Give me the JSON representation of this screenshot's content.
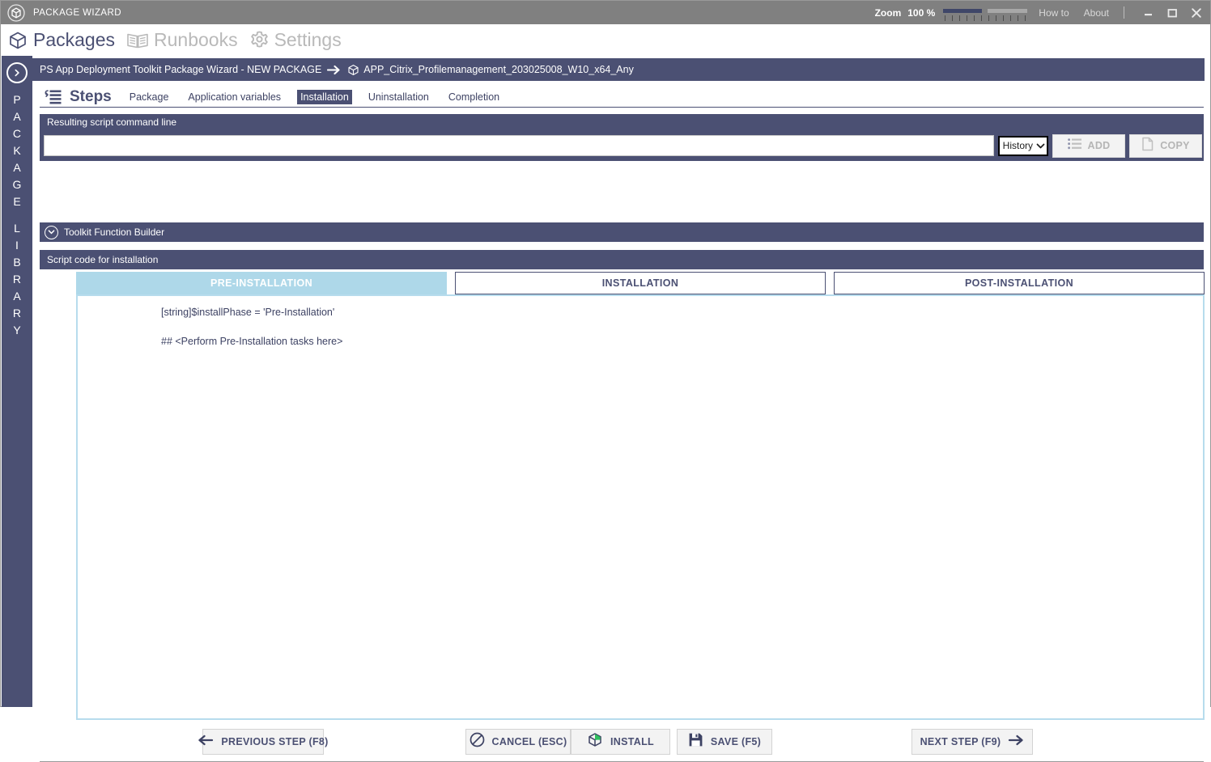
{
  "titlebar": {
    "app_title": "PACKAGE WIZARD",
    "logo_icon": "cube-icon",
    "zoom_label": "Zoom",
    "zoom_value": "100 %",
    "zoom_slider_icon": "zoom-slider",
    "how_to": "How to",
    "about": "About",
    "minimize_icon": "minimize-icon",
    "maximize_icon": "maximize-icon",
    "close_icon": "close-icon"
  },
  "topnav": {
    "items": [
      {
        "label": "Packages",
        "icon": "cube-icon",
        "active": true
      },
      {
        "label": "Runbooks",
        "icon": "book-icon",
        "active": false
      },
      {
        "label": "Settings",
        "icon": "gear-icon",
        "active": false
      }
    ]
  },
  "rail": {
    "toggle_icon": "chevron-right-icon",
    "letters": [
      "P",
      "A",
      "C",
      "K",
      "A",
      "G",
      "E",
      "",
      "L",
      "I",
      "B",
      "R",
      "A",
      "R",
      "Y"
    ]
  },
  "breadcrumb": {
    "app_path": "PS App Deployment Toolkit Package Wizard  -  NEW PACKAGE",
    "arrow_icon": "arrow-right-icon",
    "package_icon": "cube-icon",
    "package_name": "APP_Citrix_Profilemanagement_203025008_W10_x64_Any"
  },
  "steps": {
    "icon": "steps-list-icon",
    "title": "Steps",
    "tabs": [
      {
        "label": "Package",
        "active": false
      },
      {
        "label": "Application variables",
        "active": false
      },
      {
        "label": "Installation",
        "active": true
      },
      {
        "label": "Uninstallation",
        "active": false
      },
      {
        "label": "Completion",
        "active": false
      }
    ]
  },
  "command_line": {
    "header": "Resulting script command line",
    "input_value": "",
    "input_placeholder": "",
    "history_label": "History",
    "history_chevron_icon": "chevron-down-icon",
    "add_label": "ADD",
    "add_icon": "list-icon",
    "copy_label": "COPY",
    "copy_icon": "copy-page-icon"
  },
  "toolkit_builder": {
    "header": "Toolkit Function Builder",
    "expand_icon": "chevron-down-circle-icon"
  },
  "script": {
    "header": "Script code for installation",
    "tabs": [
      {
        "label": "PRE-INSTALLATION",
        "active": true
      },
      {
        "label": "INSTALLATION",
        "active": false
      },
      {
        "label": "POST-INSTALLATION",
        "active": false
      }
    ],
    "code_lines": [
      "[string]$installPhase = 'Pre-Installation'",
      "",
      "## <Perform Pre-Installation tasks here>"
    ]
  },
  "footer": {
    "previous_label": "PREVIOUS STEP (F8)",
    "previous_icon": "arrow-left-icon",
    "cancel_label": "CANCEL (ESC)",
    "cancel_icon": "no-entry-icon",
    "install_label": "INSTALL",
    "install_icon": "cube-green-icon",
    "save_label": "SAVE (F5)",
    "save_icon": "floppy-disk-icon",
    "next_label": "NEXT STEP (F9)",
    "next_icon": "arrow-right-icon"
  },
  "colors": {
    "titlebar_gray": "#808080",
    "accent_navy": "#4b5073",
    "tab_active_blue": "#aed8e9",
    "code_border_blue": "#b7dced",
    "text_navy": "#3d4263",
    "disabled_gray": "#b5b5b5"
  }
}
